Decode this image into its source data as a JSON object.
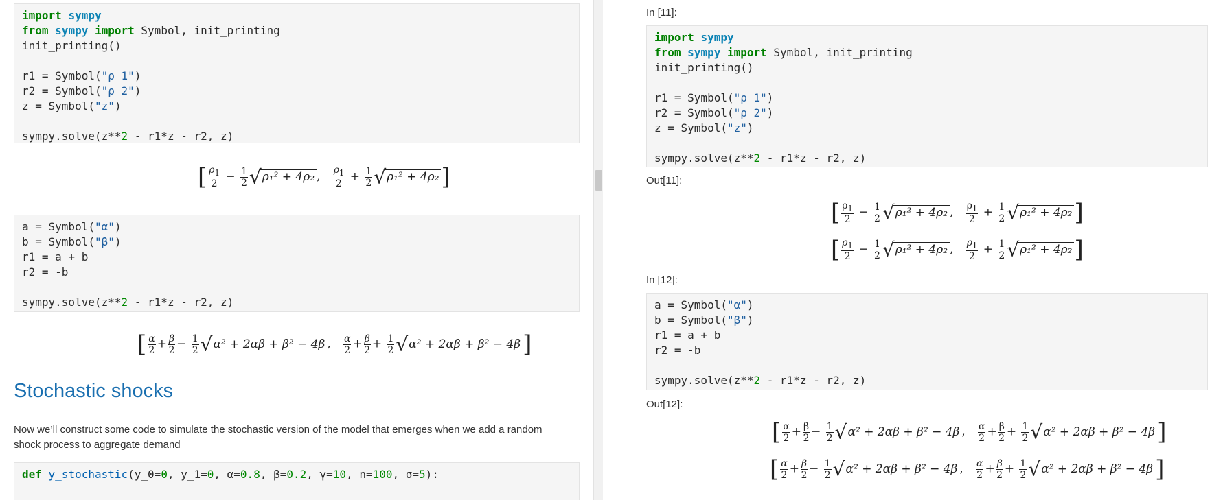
{
  "left": {
    "cell1_code": "import sympy\nfrom sympy import Symbol, init_printing\ninit_printing()\n\nr1 = Symbol(\"ρ_1\")\nr2 = Symbol(\"ρ_2\")\nz = Symbol(\"z\")\n\nsympy.solve(z**2 - r1*z - r2, z)",
    "out1": {
      "a": "ρ₁",
      "sq": "ρ₁² + 4ρ₂"
    },
    "cell2_code": "a = Symbol(\"α\")\nb = Symbol(\"β\")\nr1 = a + b\nr2 = -b\n\nsympy.solve(z**2 - r1*z - r2, z)",
    "out2": {
      "sq": "α² + 2αβ + β² − 4β"
    },
    "heading": "Stochastic shocks",
    "paragraph_line1": "Now we’ll construct some code to simulate the stochastic version of the model that emerges when we add a random",
    "paragraph_line2": "shock process to aggregate demand",
    "cell3_code": "def y_stochastic(y_0=0, y_1=0, α=0.8, β=0.2, γ=10, n=100, σ=5):"
  },
  "right": {
    "in11": "In [11]:",
    "out11": "Out[11]:",
    "in12": "In [12]:",
    "out12": "Out[12]:"
  },
  "colors": {
    "heading": "#1a6fb0",
    "keyword": "#008000",
    "module": "#0e84b5",
    "string": "#2060a0",
    "number": "#008800"
  }
}
